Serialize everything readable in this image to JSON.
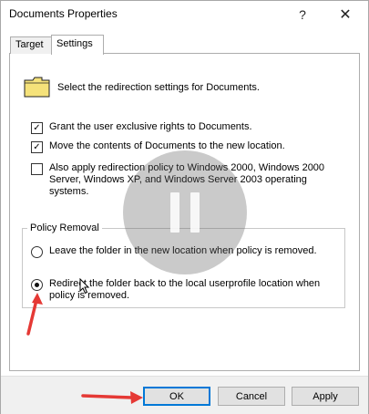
{
  "window": {
    "title": "Documents Properties",
    "help_glyph": "?",
    "close_glyph": "✕"
  },
  "tabs": [
    {
      "label": "Target",
      "active": false
    },
    {
      "label": "Settings",
      "active": true
    }
  ],
  "settings": {
    "intro_text": "Select the redirection settings for Documents.",
    "folder_icon": "folder-icon",
    "checkboxes": [
      {
        "label": "Grant the user exclusive rights to Documents.",
        "checked": true
      },
      {
        "label": "Move the contents of Documents to the new location.",
        "checked": true
      },
      {
        "label": "Also apply redirection policy to Windows 2000, Windows 2000 Server, Windows XP, and Windows Server 2003 operating systems.",
        "checked": false
      }
    ],
    "policy_removal": {
      "legend": "Policy Removal",
      "options": [
        {
          "label": "Leave the folder in the new location when policy is removed.",
          "selected": false
        },
        {
          "label": "Redirect the folder back to the local userprofile location when policy is removed.",
          "selected": true
        }
      ]
    }
  },
  "buttons": {
    "ok": "OK",
    "cancel": "Cancel",
    "apply": "Apply"
  },
  "colors": {
    "annotation_arrow": "#e53935",
    "focus_border": "#0078d7",
    "folder_fill": "#f5e27a"
  }
}
